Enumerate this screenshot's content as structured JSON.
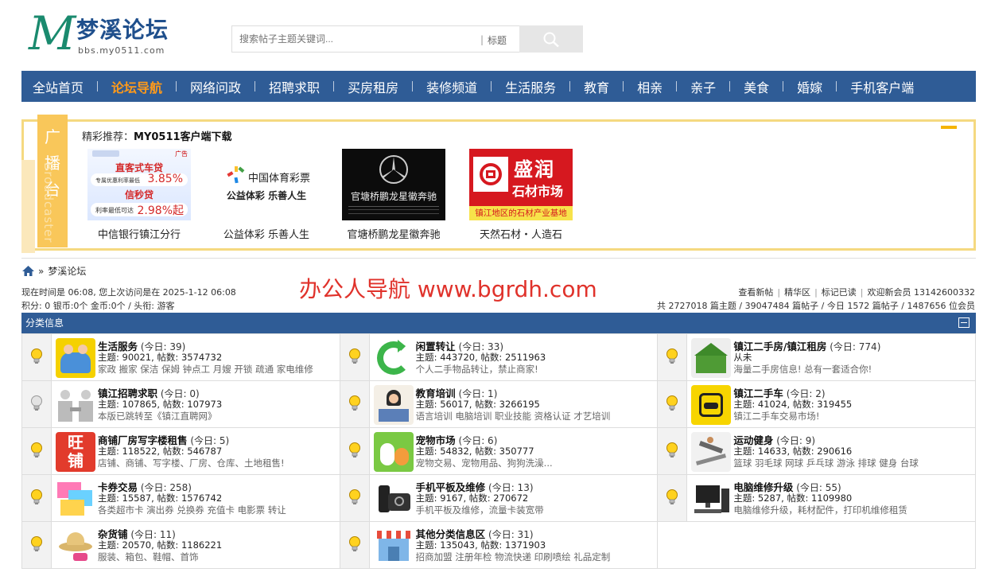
{
  "header": {
    "logo_letter": "M",
    "logo_name": "梦溪论坛",
    "logo_url": "bbs.my0511.com",
    "search_placeholder": "搜索帖子主题关键词...",
    "search_scope_sep": "|",
    "search_scope": "标题"
  },
  "nav": {
    "items": [
      "全站首页",
      "论坛导航",
      "网络问政",
      "招聘求职",
      "买房租房",
      "装修频道",
      "生活服务",
      "教育",
      "相亲",
      "亲子",
      "美食",
      "婚嫁",
      "手机客户端"
    ],
    "active_index": 1,
    "colors": {
      "bar": "#2f5c96",
      "active": "#ff9a1a"
    }
  },
  "broadcast": {
    "tab_label": "广播台",
    "tab_label_en": "Broadcaster",
    "title_prefix": "精彩推荐：",
    "title_link": "MY0511客户端下载",
    "ads": [
      {
        "caption": "中信银行镇江分行",
        "lines": [
          "直客式车贷",
          "专属优惠利率最低",
          "3.85%",
          "信秒贷",
          "利率最低可达",
          "2.98%起",
          "广告"
        ]
      },
      {
        "caption": "公益体彩 乐善人生",
        "lines": [
          "中国体育彩票",
          "公益体彩 乐善人生"
        ]
      },
      {
        "caption": "官塘桥鹏龙星徽奔驰",
        "lines": [
          "官塘桥鹏龙星徽奔驰"
        ]
      },
      {
        "caption": "天然石材・人造石",
        "lines": [
          "盛润",
          "石材市场",
          "镇江地区的石材产业基地"
        ]
      }
    ]
  },
  "breadcrumb": {
    "sep": "»",
    "current": "梦溪论坛"
  },
  "watermark": "办公人导航  www.bgrdh.com",
  "user_info": {
    "line1": "现在时间是 06:08, 您上次访问是在 2025-1-12 06:08",
    "line2": "积分: 0 银币:0个 金币:0个 / 头衔: 游客",
    "links": [
      "查看新帖",
      "精华区",
      "标记已读"
    ],
    "welcome": "欢迎新会员 13142600332",
    "stats": "共 2727018 篇主题 / 39047484 篇帖子 / 今日 1572 篇帖子 / 1487656 位会员"
  },
  "category": {
    "title": "分类信息",
    "rows": [
      [
        {
          "name": "生活服务",
          "today": "(今日: 39)",
          "stats": "主题: 90021, 帖数: 3574732",
          "desc": "家政 搬家 保洁 保姆 钟点工 月嫂 开锁 疏通 家电维修",
          "icon": "people-icon",
          "bulb": "on"
        },
        {
          "name": "闲置转让",
          "today": "(今日: 33)",
          "stats": "主题: 443720, 帖数: 2511963",
          "desc": "个人二手物品转让，禁止商家!",
          "icon": "recycle-icon",
          "bulb": "on"
        },
        {
          "name": "镇江二手房/镇江租房",
          "today": "(今日: 774)",
          "stats": "从未",
          "desc": "海量二手房信息! 总有一套适合你!",
          "icon": "house-icon",
          "bulb": "on"
        }
      ],
      [
        {
          "name": "镇江招聘求职",
          "today": "(今日: 0)",
          "stats": "主题: 107865, 帖数: 107973",
          "desc": "本版已跳转至《镇江直聘网》",
          "icon": "handshake-icon",
          "bulb": "off"
        },
        {
          "name": "教育培训",
          "today": "(今日: 1)",
          "stats": "主题: 56017, 帖数: 3266195",
          "desc": "语言培训 电脑培训 职业技能 资格认证 才艺培训",
          "icon": "student-icon",
          "bulb": "on"
        },
        {
          "name": "镇江二手车",
          "today": "(今日: 2)",
          "stats": "主题: 41024, 帖数: 319455",
          "desc": "镇江二手车交易市场!",
          "icon": "car-icon",
          "bulb": "on"
        }
      ],
      [
        {
          "name": "商铺厂房写字楼租售",
          "today": "(今日: 5)",
          "stats": "主题: 118522, 帖数: 546787",
          "desc": "店铺、商铺、写字楼、厂房、仓库、土地租售!",
          "icon": "shop-icon",
          "bulb": "on",
          "icon_text": [
            "旺",
            "铺"
          ]
        },
        {
          "name": "宠物市场",
          "today": "(今日: 6)",
          "stats": "主题: 54832, 帖数: 350777",
          "desc": "宠物交易、宠物用品、狗狗洗澡...",
          "icon": "pet-icon",
          "bulb": "on"
        },
        {
          "name": "运动健身",
          "today": "(今日: 9)",
          "stats": "主题: 14633, 帖数: 290616",
          "desc": "篮球 羽毛球 网球 乒乓球 游泳 排球 健身 台球",
          "icon": "runner-icon",
          "bulb": "on"
        }
      ],
      [
        {
          "name": "卡券交易",
          "today": "(今日: 258)",
          "stats": "主题: 15587, 帖数: 1576742",
          "desc": "各类超市卡 演出券 兑换券 充值卡 电影票 转让",
          "icon": "coupon-icon",
          "bulb": "on"
        },
        {
          "name": "手机平板及维修",
          "today": "(今日: 13)",
          "stats": "主题: 9167, 帖数: 270672",
          "desc": "手机平板及维修，流量卡装宽带",
          "icon": "phone-camera-icon",
          "bulb": "on"
        },
        {
          "name": "电脑维修升级",
          "today": "(今日: 55)",
          "stats": "主题: 5287, 帖数: 1109980",
          "desc": "电脑维修升级，耗材配件，打印机维修租赁",
          "icon": "computer-icon",
          "bulb": "on"
        }
      ],
      [
        {
          "name": "杂货铺",
          "today": "(今日: 11)",
          "stats": "主题: 20570, 帖数: 1186221",
          "desc": "服装、箱包、鞋帽、首饰",
          "icon": "hat-icon",
          "bulb": "on"
        },
        {
          "name": "其他分类信息区",
          "today": "(今日: 31)",
          "stats": "主题: 135043, 帖数: 1371903",
          "desc": "招商加盟 注册年检 物流快递 印刷喷绘 礼品定制",
          "icon": "store-icon",
          "bulb": "on"
        }
      ]
    ]
  }
}
